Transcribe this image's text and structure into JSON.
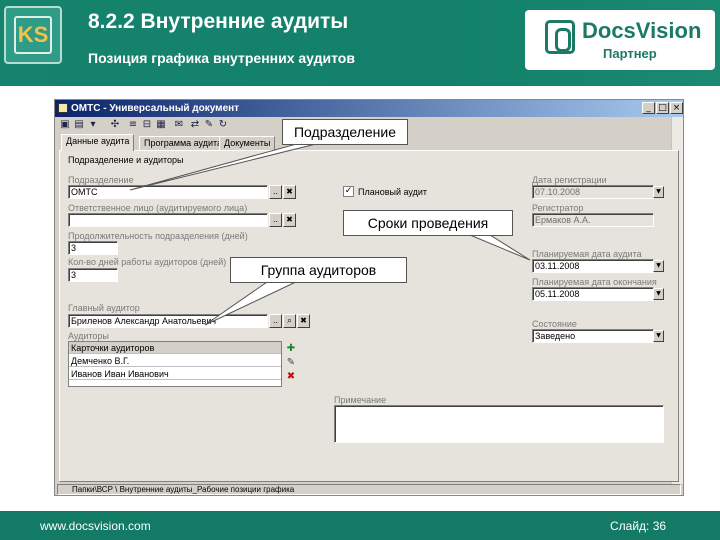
{
  "header": {
    "title": "8.2.2 Внутренние аудиты",
    "subtitle": "Позиция графика внутренних аудитов",
    "logo_left_text": "KS",
    "brand_name": "DocsVision",
    "brand_partner": "Партнер"
  },
  "footer": {
    "url": "www.docsvision.com",
    "slide_label": "Слайд: 36"
  },
  "window": {
    "title": "ОМТС - Универсальный документ",
    "controls": [
      "_",
      "□",
      "×"
    ],
    "tabs": [
      "Данные аудита",
      "Программа аудита",
      "Документы"
    ],
    "status_text": "Папки\\ВСР \\ Внутренние аудиты_Рабочие позиции графика",
    "form": {
      "section_title": "Подразделение и аудиторы",
      "subdivision_label": "Подразделение",
      "subdivision_value": "ОМТС",
      "responsible_label": "Ответственное лицо (аудитируемого лица)",
      "responsible_value": "",
      "head_label": "Продолжительность подразделения (дней)",
      "head_value": "3",
      "audit_days_label": "Кол-во дней работы аудиторов (дней)",
      "audit_days_value": "3",
      "lead_auditor_label": "Главный аудитор",
      "lead_auditor_value": "Бриленов Александр Анатольевич",
      "auditors_label": "Аудиторы",
      "auditors_header": "Карточки аудиторов",
      "auditors": [
        "Демченко В.Г.",
        "Иванов Иван Иванович"
      ],
      "planned_audit_label": "Плановый аудит",
      "planned_audit_checked": true,
      "reg_date_label": "Дата регистрации",
      "reg_date_value": "07.10.2008",
      "registrar_label": "Регистратор",
      "registrar_value": "Ермаков А.А.",
      "planned_date_label": "Планируемая дата аудита",
      "planned_date_value": "03.11.2008",
      "planned_end_label": "Планируемая дата окончания",
      "planned_end_value": "05.11.2008",
      "state_label": "Состояние",
      "state_value": "Заведено",
      "note_label": "Примечание",
      "note_value": ""
    }
  },
  "callouts": {
    "subdivision": "Подразделение",
    "deadlines": "Сроки проведения",
    "auditors_group": "Группа аудиторов"
  },
  "colors": {
    "header_green": "#16836d",
    "footer_green": "#127a65",
    "window_title": "#0a246a"
  }
}
